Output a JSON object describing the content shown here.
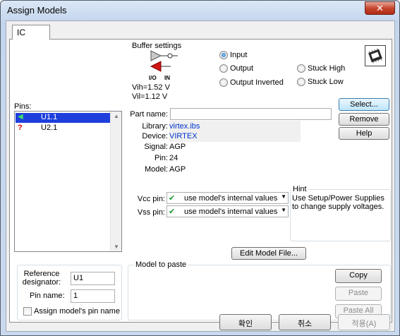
{
  "window": {
    "title": "Assign Models",
    "close_label": "✕"
  },
  "tab": {
    "label": "IC"
  },
  "pins": {
    "label": "Pins:",
    "items": [
      {
        "icon": "arrow-left-icon",
        "glyph": "➜",
        "name": "U1.1"
      },
      {
        "icon": "question-icon",
        "glyph": "?",
        "name": "U2.1"
      }
    ]
  },
  "buffer": {
    "title": "Buffer settings",
    "io_label": "I/O",
    "in_label": "IN",
    "vih": "Vih=1.52 V",
    "vil": "Vil=1.12 V",
    "options": {
      "input": "Input",
      "output": "Output",
      "output_inverted": "Output Inverted",
      "stuck_high": "Stuck High",
      "stuck_low": "Stuck Low"
    },
    "selected": "input"
  },
  "details": {
    "part_name_label": "Part name:",
    "part_name_value": "",
    "library_label": "Library:",
    "library_value": "virtex.ibs",
    "device_label": "Device:",
    "device_value": "VIRTEX",
    "signal_label": "Signal:",
    "signal_value": "AGP",
    "pin_label": "Pin:",
    "pin_value": "24",
    "model_label": "Model:",
    "model_value": "AGP"
  },
  "side_buttons": {
    "select": "Select...",
    "remove": "Remove",
    "help": "Help"
  },
  "supply": {
    "vcc_label": "Vcc pin:",
    "vcc_value": "use model's internal values",
    "vss_label": "Vss pin:",
    "vss_value": "use model's internal values"
  },
  "hint": {
    "title": "Hint",
    "text": "Use Setup/Power Supplies to change supply voltages."
  },
  "edit_model_file": "Edit Model File...",
  "reference": {
    "designator_label": "Reference designator:",
    "designator_value": "U1",
    "pin_name_label": "Pin name:",
    "pin_name_value": "1",
    "assign_checkbox": "Assign model's pin name"
  },
  "paste": {
    "title": "Model to paste",
    "copy": "Copy",
    "paste": "Paste",
    "paste_all": "Paste All"
  },
  "footer": {
    "ok": "확인",
    "cancel": "취소",
    "apply": "적용(A)"
  },
  "colors": {
    "accent_select": "#1e3fdc",
    "link": "#0033cc",
    "input_triangle": "#d11414"
  }
}
